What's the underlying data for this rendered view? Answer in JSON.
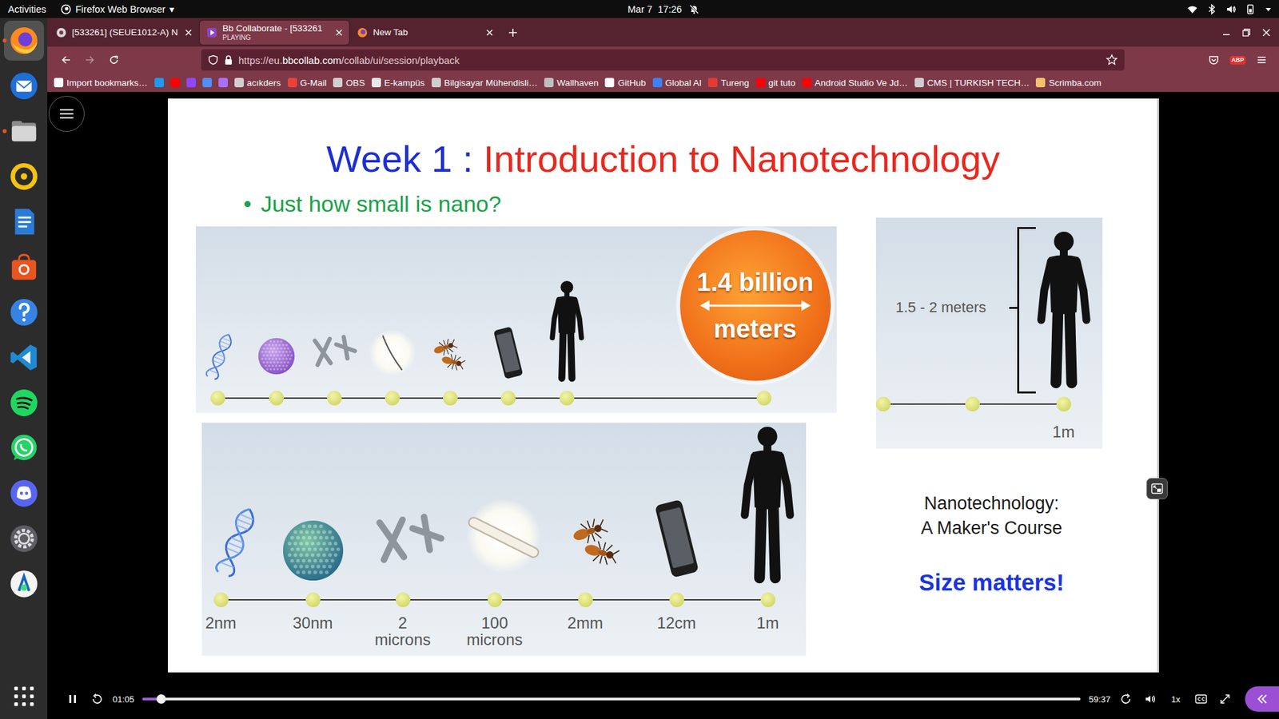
{
  "topbar": {
    "activities": "Activities",
    "app": "Firefox Web Browser",
    "caret": "▾",
    "clock": "Mar 7  17:26"
  },
  "dock": {
    "items": [
      {
        "running": true,
        "selected": true
      },
      {
        "running": false,
        "selected": false
      },
      {
        "running": true,
        "selected": false
      },
      {
        "running": false,
        "selected": false
      },
      {
        "running": false,
        "selected": false
      },
      {
        "running": false,
        "selected": false
      },
      {
        "running": false,
        "selected": false
      },
      {
        "running": false,
        "selected": false
      },
      {
        "running": false,
        "selected": false
      },
      {
        "running": false,
        "selected": false
      },
      {
        "running": false,
        "selected": false
      },
      {
        "running": false,
        "selected": false
      },
      {
        "running": false,
        "selected": false
      }
    ]
  },
  "browser": {
    "tabs": [
      {
        "label": "[533261] (SEUE1012-A) N",
        "selected": false
      },
      {
        "label": "Bb Collaborate - [533261",
        "sublabel": "PLAYING",
        "selected": true
      },
      {
        "label": "New Tab",
        "selected": false
      }
    ],
    "forward_enabled": false,
    "url": {
      "scheme": "https://eu.",
      "domain": "bbcollab.com",
      "path": "/collab/ui/session/playback"
    },
    "abp": "ABP",
    "bookmarks": [
      {
        "label": "Import bookmarks…",
        "color": "#ffffff"
      },
      {
        "color": "#1d9bf0"
      },
      {
        "color": "#ff0000"
      },
      {
        "color": "#9146ff"
      },
      {
        "color": "#4f8ff7"
      },
      {
        "color": "#a970ff"
      },
      {
        "label": "acıkders",
        "color": "#d0d0d0"
      },
      {
        "label": "G-Mail",
        "color": "#ea4335"
      },
      {
        "label": "OBS",
        "color": "#d0d0d0"
      },
      {
        "label": "E-kampüs",
        "color": "#e8e8e8"
      },
      {
        "label": "Bilgisayar Mühendisli…",
        "color": "#cfcfcf"
      },
      {
        "label": "Wallhaven",
        "color": "#bfbfbf"
      },
      {
        "label": "GitHub",
        "color": "#ffffff"
      },
      {
        "label": "Global AI",
        "color": "#3b82f6"
      },
      {
        "label": "Tureng",
        "color": "#e53935"
      },
      {
        "label": "git tuto",
        "color": "#ff0000"
      },
      {
        "label": "Android Studio Ve Jd…",
        "color": "#ff0000"
      },
      {
        "label": "CMS | TURKISH TECH…",
        "color": "#cfcfcf"
      },
      {
        "label": "Scrimba.com",
        "color": "#f5c26b"
      }
    ]
  },
  "player": {
    "slide": {
      "title_lead": "Week 1",
      "title_sep": ":",
      "title_main": "Introduction to Nanotechnology",
      "bullet": "•",
      "subtitle": "Just how small is nano?",
      "sun_label": [
        "1.4 billion",
        "meters"
      ],
      "height_label": "1.5 - 2 meters",
      "height_tick": "1m",
      "scale_labels": [
        "2nm",
        "30nm",
        "2\nmicrons",
        "100\nmicrons",
        "2mm",
        "12cm",
        "1m"
      ],
      "course": [
        "Nanotechnology:",
        "A Maker's Course"
      ],
      "tagline": "Size matters!"
    },
    "controls": {
      "playing": true,
      "elapsed": "01:05",
      "duration": "59:37",
      "level": 0.02,
      "speed": "1x"
    }
  }
}
